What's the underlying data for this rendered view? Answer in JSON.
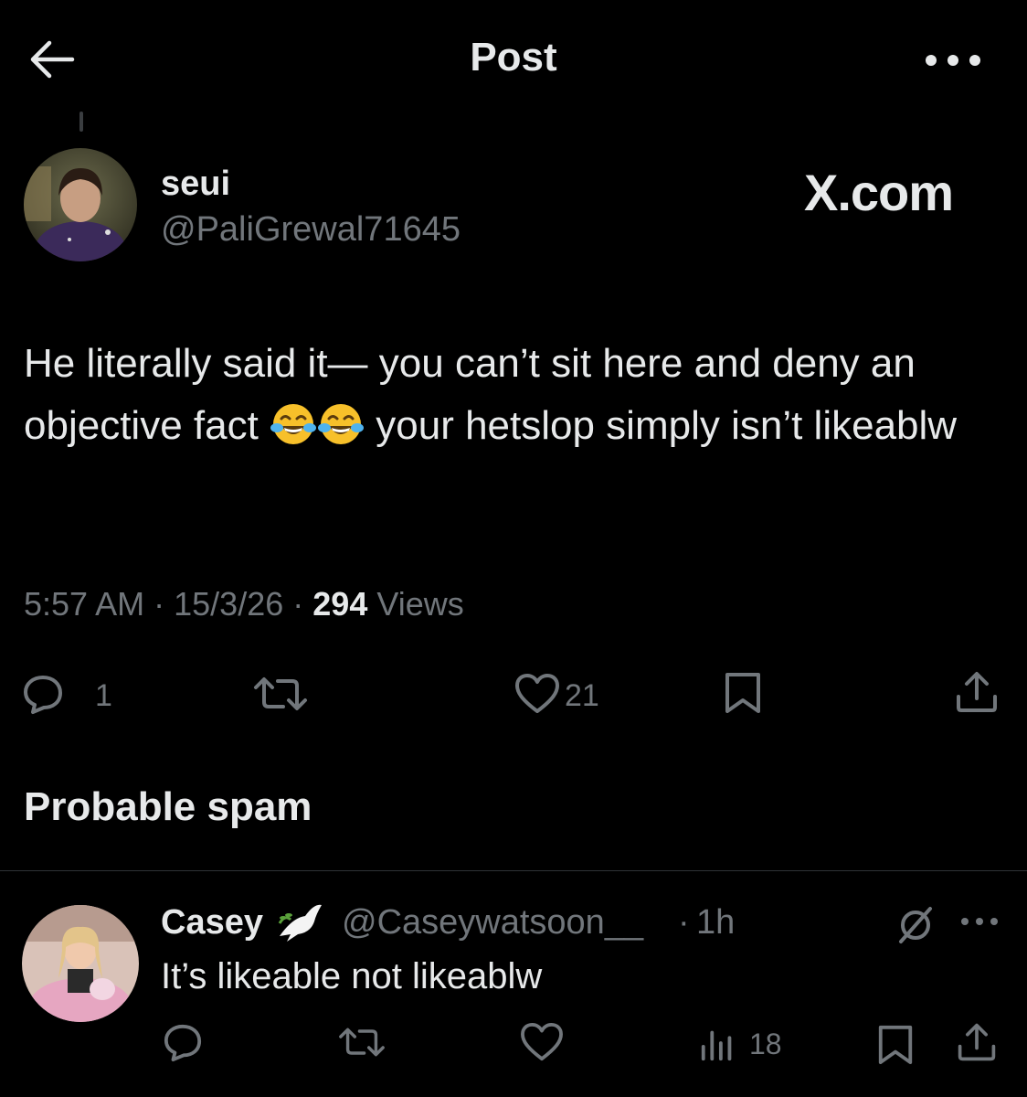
{
  "header": {
    "title": "Post",
    "back_icon": "arrow-left-icon",
    "more_icon": "more-horizontal-icon"
  },
  "post": {
    "author_name": "seui",
    "author_handle": "@PaliGrewal71645",
    "badge_text": "X.com",
    "text_part1": "He literally said it— you can’t sit here and deny an objective fact ",
    "text_part2": " your hetslop simply isn’t likeablw",
    "emoji": "face-with-tears-of-joy",
    "time": "5:57 AM",
    "date": "15/3/26",
    "views_count": "294",
    "views_label": "Views",
    "separator": "·"
  },
  "actions": {
    "replies": "1",
    "likes": "21"
  },
  "section": {
    "title": "Probable spam"
  },
  "reply": {
    "name": "Casey",
    "handle": "@Caseywatsoon__",
    "separator": "·",
    "time": "1h",
    "text": "It’s likeable not likeablw",
    "views": "18"
  },
  "colors": {
    "background": "#000000",
    "text": "#e7e9ea",
    "secondary": "#71767b",
    "divider": "#2f3336"
  }
}
